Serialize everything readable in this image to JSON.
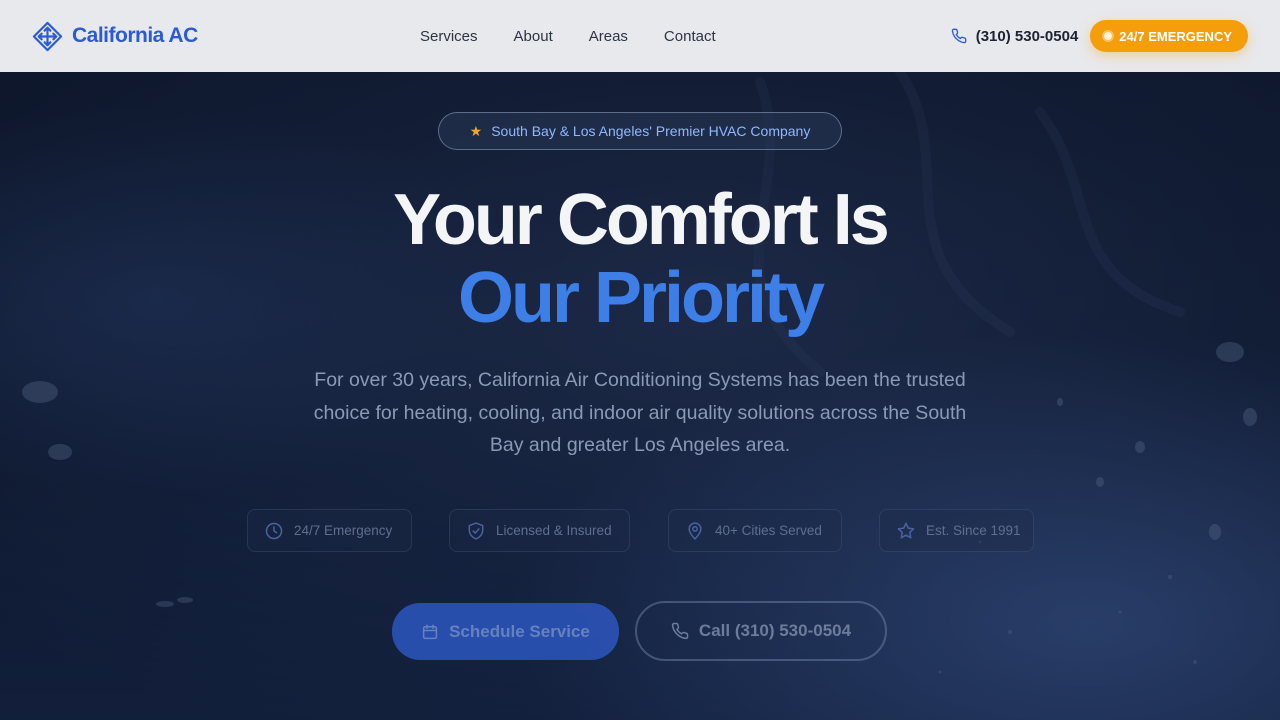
{
  "brand": {
    "name": "California AC",
    "logo_icon": "diamond-arrows-icon",
    "color": "#2c5ad6"
  },
  "nav": {
    "items": [
      {
        "label": "Services"
      },
      {
        "label": "About"
      },
      {
        "label": "Areas"
      },
      {
        "label": "Contact"
      }
    ]
  },
  "header": {
    "phone": "(310) 530-0504",
    "phone_icon": "phone-icon",
    "emergency_label": "24/7 EMERGENCY",
    "emergency_color": "#f59e0b"
  },
  "hero": {
    "badge": "South Bay & Los Angeles' Premier HVAC Company",
    "badge_icon": "star-icon",
    "title_line1": "Your Comfort Is",
    "title_line2": "Our Priority",
    "accent_color": "#3d7fe6",
    "description": "For over 30 years, California Air Conditioning Systems has been the trusted choice for heating, cooling, and indoor air quality solutions across the South Bay and greater Los Angeles area.",
    "features": [
      {
        "label": "24/7 Emergency",
        "icon": "clock-icon"
      },
      {
        "label": "Licensed & Insured",
        "icon": "shield-check-icon"
      },
      {
        "label": "40+ Cities Served",
        "icon": "map-pin-icon"
      },
      {
        "label": "Est. Since 1991",
        "icon": "star-outline-icon"
      }
    ],
    "cta_primary": "Schedule Service",
    "cta_primary_icon": "calendar-icon",
    "cta_secondary": "Call (310) 530-0504",
    "cta_secondary_icon": "phone-icon"
  }
}
